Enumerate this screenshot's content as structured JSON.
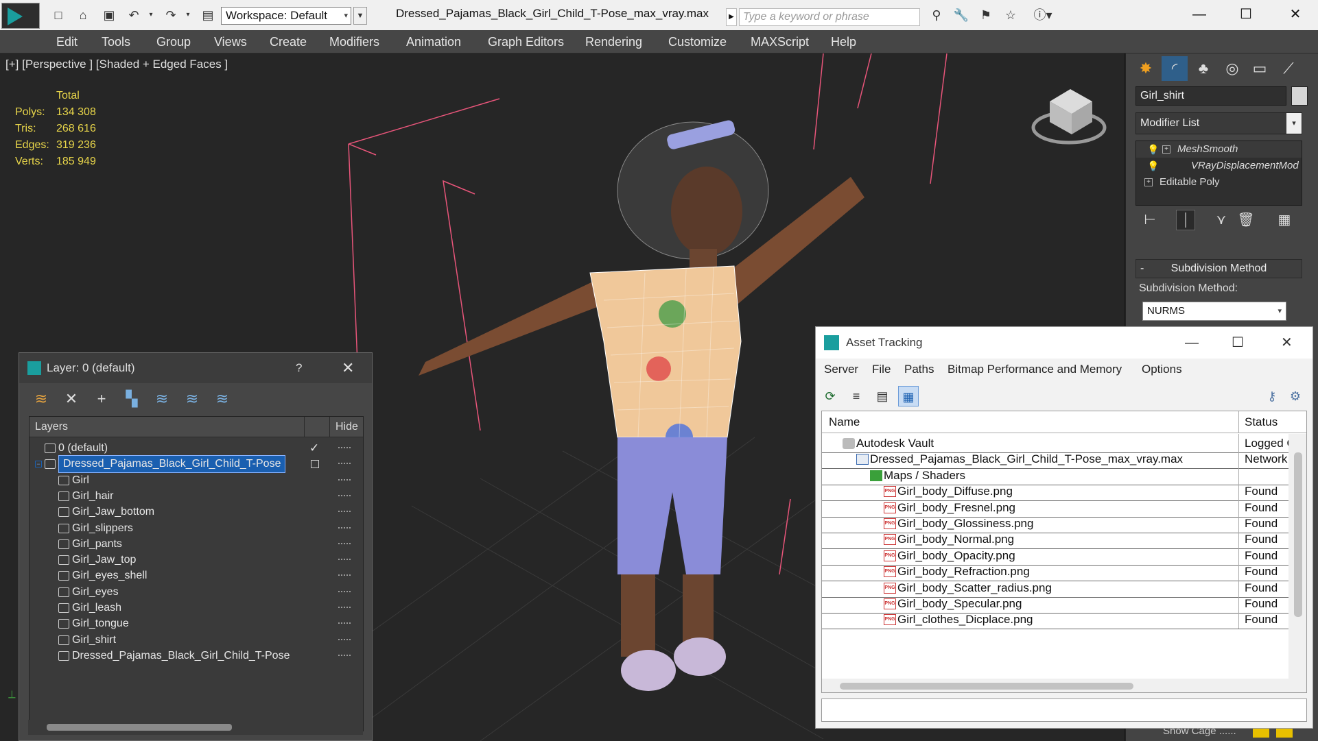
{
  "titlebar": {
    "workspace_label": "Workspace: Default",
    "document_title": "Dressed_Pajamas_Black_Girl_Child_T-Pose_max_vray.max",
    "search_placeholder": "Type a keyword or phrase"
  },
  "menubar": [
    "Edit",
    "Tools",
    "Group",
    "Views",
    "Create",
    "Modifiers",
    "Animation",
    "Graph Editors",
    "Rendering",
    "Customize",
    "MAXScript",
    "Help"
  ],
  "viewport": {
    "label": "[+] [Perspective ] [Shaded + Edged Faces ]",
    "stats": {
      "header": "Total",
      "rows": [
        {
          "label": "Polys:",
          "value": "134 308"
        },
        {
          "label": "Tris:",
          "value": "268 616"
        },
        {
          "label": "Edges:",
          "value": "319 236"
        },
        {
          "label": "Verts:",
          "value": "185 949"
        }
      ]
    }
  },
  "command_panel": {
    "object_name": "Girl_shirt",
    "modifier_list": "Modifier List",
    "stack": [
      "MeshSmooth",
      "VRayDisplacementMod",
      "Editable Poly"
    ],
    "rollout_title": "Subdivision Method",
    "subdivision_label": "Subdivision Method:",
    "subdivision_value": "NURMS",
    "show_cage": "Show Cage ......",
    "cage_colors": [
      "#e8c000",
      "#e8c000"
    ]
  },
  "layer_window": {
    "title": "Layer: 0 (default)",
    "help": "?",
    "col_layers": "Layers",
    "col_hide": "Hide",
    "rows": [
      {
        "name": "0 (default)",
        "indent": 0,
        "type": "layer",
        "current": true
      },
      {
        "name": "Dressed_Pajamas_Black_Girl_Child_T-Pose",
        "indent": 0,
        "type": "layer",
        "selected": true
      },
      {
        "name": "Girl",
        "indent": 1,
        "type": "object"
      },
      {
        "name": "Girl_hair",
        "indent": 1,
        "type": "object"
      },
      {
        "name": "Girl_Jaw_bottom",
        "indent": 1,
        "type": "object"
      },
      {
        "name": "Girl_slippers",
        "indent": 1,
        "type": "object"
      },
      {
        "name": "Girl_pants",
        "indent": 1,
        "type": "object"
      },
      {
        "name": "Girl_Jaw_top",
        "indent": 1,
        "type": "object"
      },
      {
        "name": "Girl_eyes_shell",
        "indent": 1,
        "type": "object"
      },
      {
        "name": "Girl_eyes",
        "indent": 1,
        "type": "object"
      },
      {
        "name": "Girl_leash",
        "indent": 1,
        "type": "object"
      },
      {
        "name": "Girl_tongue",
        "indent": 1,
        "type": "object"
      },
      {
        "name": "Girl_shirt",
        "indent": 1,
        "type": "object"
      },
      {
        "name": "Dressed_Pajamas_Black_Girl_Child_T-Pose",
        "indent": 1,
        "type": "object"
      }
    ]
  },
  "asset_window": {
    "title": "Asset Tracking",
    "menu": [
      "Server",
      "File",
      "Paths",
      "Bitmap Performance and Memory",
      "Options"
    ],
    "col_name": "Name",
    "col_status": "Status",
    "rows": [
      {
        "name": "Autodesk Vault",
        "status": "Logged O",
        "indent": 0,
        "icon": "vault"
      },
      {
        "name": "Dressed_Pajamas_Black_Girl_Child_T-Pose_max_vray.max",
        "status": "Network",
        "indent": 1,
        "icon": "max"
      },
      {
        "name": "Maps / Shaders",
        "status": "",
        "indent": 2,
        "icon": "maps"
      },
      {
        "name": "Girl_body_Diffuse.png",
        "status": "Found",
        "indent": 3,
        "icon": "png"
      },
      {
        "name": "Girl_body_Fresnel.png",
        "status": "Found",
        "indent": 3,
        "icon": "png"
      },
      {
        "name": "Girl_body_Glossiness.png",
        "status": "Found",
        "indent": 3,
        "icon": "png"
      },
      {
        "name": "Girl_body_Normal.png",
        "status": "Found",
        "indent": 3,
        "icon": "png"
      },
      {
        "name": "Girl_body_Opacity.png",
        "status": "Found",
        "indent": 3,
        "icon": "png"
      },
      {
        "name": "Girl_body_Refraction.png",
        "status": "Found",
        "indent": 3,
        "icon": "png"
      },
      {
        "name": "Girl_body_Scatter_radius.png",
        "status": "Found",
        "indent": 3,
        "icon": "png"
      },
      {
        "name": "Girl_body_Specular.png",
        "status": "Found",
        "indent": 3,
        "icon": "png"
      },
      {
        "name": "Girl_clothes_Dicplace.png",
        "status": "Found",
        "indent": 3,
        "icon": "png"
      }
    ]
  },
  "colors": {
    "accent": "#1a9e9e",
    "stats_yellow": "#e9d64a",
    "selection_blue": "#1a5fb0",
    "bbox_pink": "#e8557a"
  }
}
